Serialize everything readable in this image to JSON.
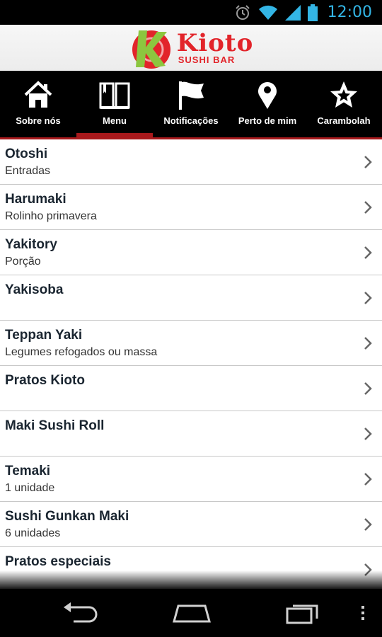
{
  "status": {
    "time": "12:00"
  },
  "brand": {
    "name": "Kioto",
    "subtitle": "SUSHI BAR",
    "accent_color": "#e2242a"
  },
  "tabs": [
    {
      "label": "Sobre nós",
      "icon": "home-icon",
      "active": false
    },
    {
      "label": "Menu",
      "icon": "book-icon",
      "active": true
    },
    {
      "label": "Notificações",
      "icon": "flag-icon",
      "active": false
    },
    {
      "label": "Perto de mim",
      "icon": "location-pin-icon",
      "active": false
    },
    {
      "label": "Carambolah",
      "icon": "star-icon",
      "active": false
    }
  ],
  "menu": {
    "items": [
      {
        "title": "Otoshi",
        "subtitle": "Entradas"
      },
      {
        "title": "Harumaki",
        "subtitle": "Rolinho primavera"
      },
      {
        "title": "Yakitory",
        "subtitle": "Porção"
      },
      {
        "title": "Yakisoba",
        "subtitle": ""
      },
      {
        "title": "Teppan Yaki",
        "subtitle": "Legumes refogados ou massa"
      },
      {
        "title": "Pratos Kioto",
        "subtitle": ""
      },
      {
        "title": "Maki Sushi Roll",
        "subtitle": ""
      },
      {
        "title": "Temaki",
        "subtitle": "1 unidade"
      },
      {
        "title": "Sushi Gunkan Maki",
        "subtitle": "6 unidades"
      },
      {
        "title": "Pratos especiais",
        "subtitle": ""
      }
    ]
  },
  "colors": {
    "tab_indicator": "#a8191c",
    "status_accent": "#33b5e5"
  }
}
